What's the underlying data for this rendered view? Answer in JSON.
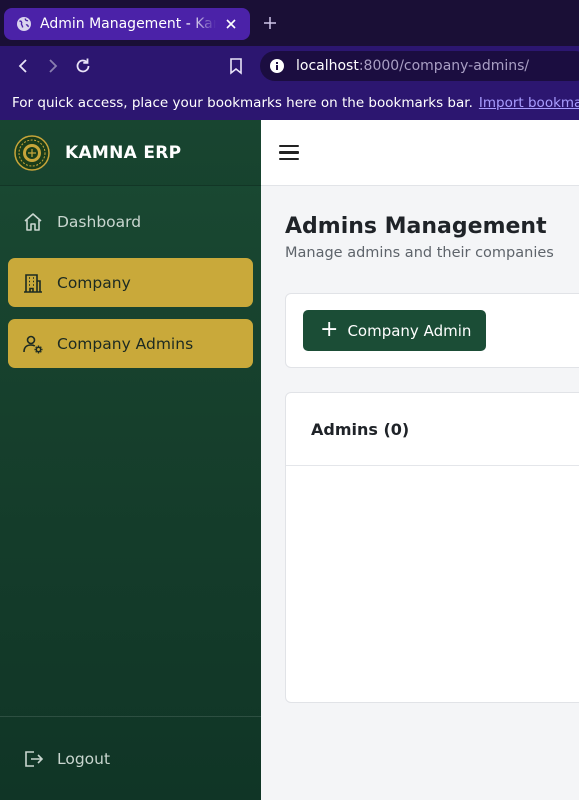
{
  "browser": {
    "tab_title": "Admin Management - Kamna ERP",
    "url_host": "localhost",
    "url_rest": ":8000/company-admins/",
    "bookmarks_prompt": "For quick access, place your bookmarks here on the bookmarks bar.",
    "bookmarks_link": "Import bookmarks..."
  },
  "sidebar": {
    "brand": "KAMNA ERP",
    "items": [
      {
        "label": "Dashboard",
        "icon": "home-icon",
        "active": false
      },
      {
        "label": "Company",
        "icon": "building-icon",
        "active": true
      },
      {
        "label": "Company Admins",
        "icon": "user-cog-icon",
        "active": true
      }
    ],
    "logout_label": "Logout"
  },
  "main": {
    "title": "Admins Management",
    "subtitle": "Manage admins and their companies",
    "add_button_label": "Company Admin",
    "list_title": "Admins (0)"
  },
  "colors": {
    "browser_tab": "#4b22a8",
    "browser_toolbar": "#2c1670",
    "sidebar_bg": "#1a4a33",
    "active_item": "#c9a93a",
    "primary_button": "#1b4d36"
  }
}
